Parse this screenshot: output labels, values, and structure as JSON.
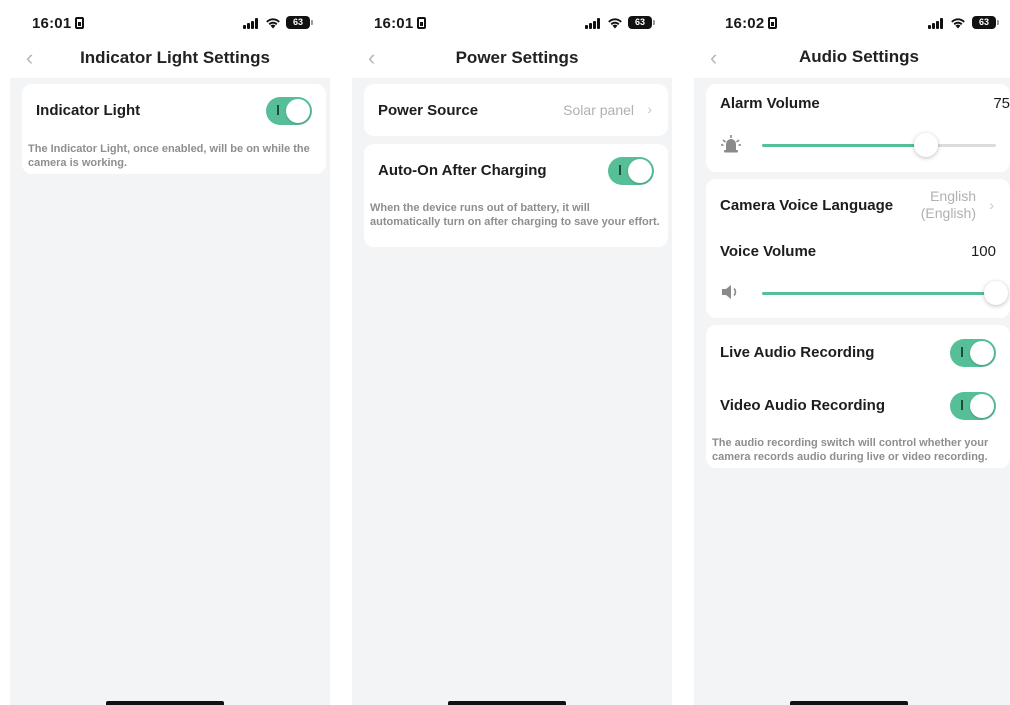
{
  "screens": [
    {
      "status": {
        "time": "16:01",
        "battery": "63"
      },
      "nav": {
        "title": "Indicator Light Settings",
        "back_glyph": "‹"
      },
      "indicator": {
        "label": "Indicator Light",
        "enabled": true,
        "description": "The Indicator Light, once enabled, will be on while the camera is working."
      }
    },
    {
      "status": {
        "time": "16:01",
        "battery": "63"
      },
      "nav": {
        "title": "Power Settings",
        "back_glyph": "‹"
      },
      "power_source": {
        "label": "Power Source",
        "value": "Solar panel",
        "chevron": "›"
      },
      "auto_on": {
        "label": "Auto-On After Charging",
        "enabled": true,
        "description": "When the device runs out of battery, it will automatically turn on after charging to save your effort."
      }
    },
    {
      "status": {
        "time": "16:02",
        "battery": "63"
      },
      "nav": {
        "title": "Audio Settings",
        "back_glyph": "‹"
      },
      "alarm_volume": {
        "label": "Alarm Volume",
        "value": "75",
        "level": 0.7
      },
      "voice_language": {
        "label": "Camera Voice Language",
        "value_line1": "English",
        "value_line2": "(English)",
        "chevron": "›"
      },
      "voice_volume": {
        "label": "Voice Volume",
        "value": "100",
        "level": 1.0
      },
      "live_audio": {
        "label": "Live Audio Recording",
        "enabled": true
      },
      "video_audio": {
        "label": "Video Audio Recording",
        "enabled": true
      },
      "audio_description": "The audio recording switch will control whether your camera records audio during live or video recording."
    }
  ],
  "colors": {
    "accent": "#56bf97",
    "background": "#f3f4f6",
    "secondary_text": "#b0b0b0"
  },
  "icons": [
    "chevron-left-icon",
    "chevron-right-icon",
    "alarm-bell-icon",
    "speaker-icon",
    "signal-icon",
    "wifi-icon",
    "battery-icon",
    "sim-icon"
  ]
}
